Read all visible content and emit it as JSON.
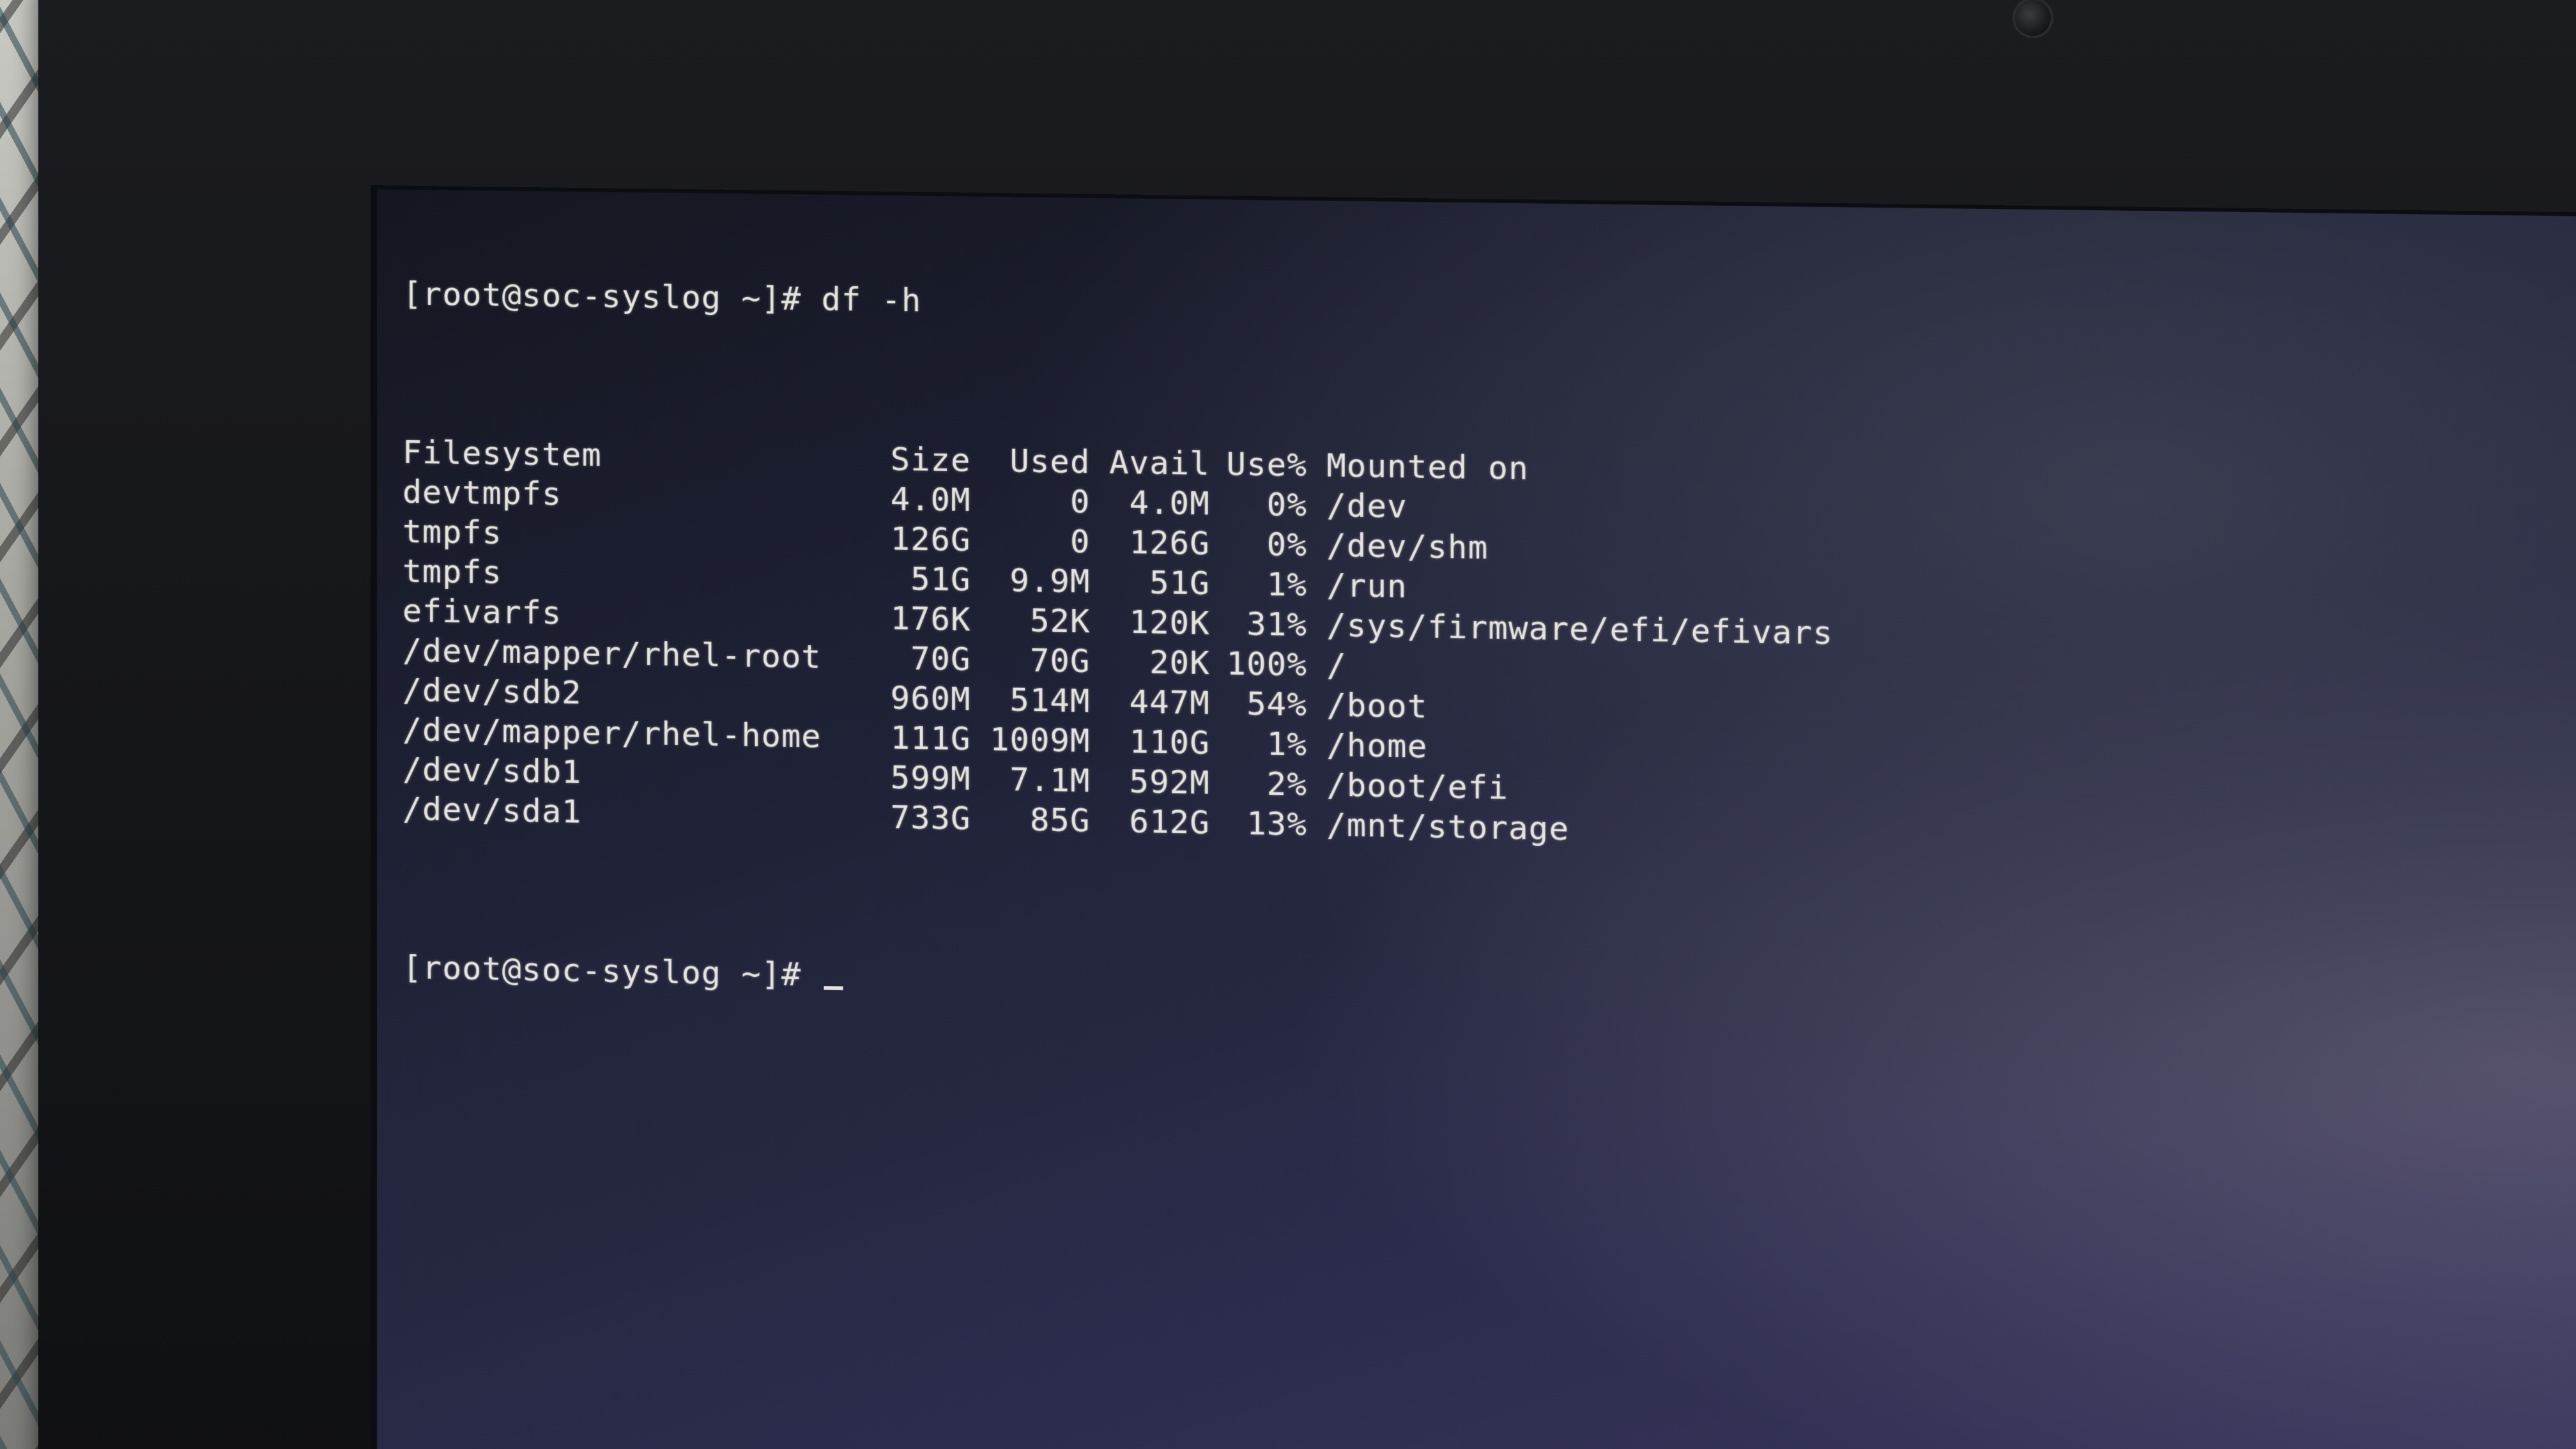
{
  "terminal": {
    "command_line": "[root@soc-syslog ~]# df -h",
    "headers": [
      "Filesystem",
      "Size",
      "Used",
      "Avail",
      "Use%",
      "Mounted on"
    ],
    "rows": [
      [
        "devtmpfs",
        "4.0M",
        "0",
        "4.0M",
        "0%",
        "/dev"
      ],
      [
        "tmpfs",
        "126G",
        "0",
        "126G",
        "0%",
        "/dev/shm"
      ],
      [
        "tmpfs",
        "51G",
        "9.9M",
        "51G",
        "1%",
        "/run"
      ],
      [
        "efivarfs",
        "176K",
        "52K",
        "120K",
        "31%",
        "/sys/firmware/efi/efivars"
      ],
      [
        "/dev/mapper/rhel-root",
        "70G",
        "70G",
        "20K",
        "100%",
        "/"
      ],
      [
        "/dev/sdb2",
        "960M",
        "514M",
        "447M",
        "54%",
        "/boot"
      ],
      [
        "/dev/mapper/rhel-home",
        "111G",
        "1009M",
        "110G",
        "1%",
        "/home"
      ],
      [
        "/dev/sdb1",
        "599M",
        "7.1M",
        "592M",
        "2%",
        "/boot/efi"
      ],
      [
        "/dev/sda1",
        "733G",
        "85G",
        "612G",
        "13%",
        "/mnt/storage"
      ]
    ],
    "prompt": "[root@soc-syslog ~]#"
  }
}
